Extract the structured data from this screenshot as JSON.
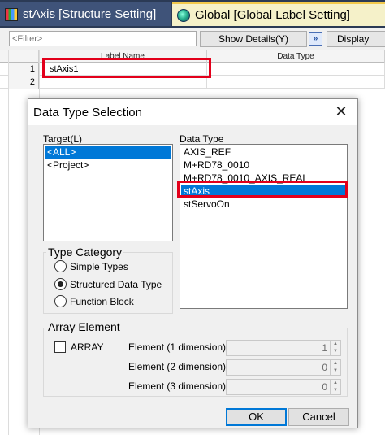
{
  "tabs": [
    {
      "label": "stAxis [Structure Setting]",
      "icon": "structure-icon"
    },
    {
      "label": "Global [Global Label Setting]",
      "icon": "globe-icon"
    }
  ],
  "toolbar": {
    "filter_placeholder": "<Filter>",
    "show_details_label": "Show Details(Y)",
    "expand_icon": "double-chevron-right-icon",
    "display_label": "Display"
  },
  "grid": {
    "columns": [
      "Label Name",
      "Data Type"
    ],
    "rows": [
      {
        "num": "1",
        "label_name": "stAxis1",
        "data_type": ""
      },
      {
        "num": "2",
        "label_name": "",
        "data_type": ""
      }
    ],
    "highlight_color": "#e3001b"
  },
  "dialog": {
    "title": "Data Type Selection",
    "close_icon": "close-icon",
    "target_label": "Target(L)",
    "target_items": [
      "<ALL>",
      "<Project>"
    ],
    "target_selected": "<ALL>",
    "data_type_label": "Data Type",
    "data_type_items": [
      "AXIS_REF",
      "M+RD78_0010",
      "M+RD78_0010_AXIS_REAL",
      "stAxis",
      "stServoOn"
    ],
    "data_type_selected": "stAxis",
    "type_category": {
      "title": "Type Category",
      "options": [
        "Simple Types",
        "Structured Data Type",
        "Function Block"
      ],
      "selected": "Structured Data Type"
    },
    "array_element": {
      "title": "Array Element",
      "checkbox_label": "ARRAY",
      "checked": false,
      "dimensions": [
        {
          "label": "Element (1 dimension)",
          "value": "1"
        },
        {
          "label": "Element (2 dimension)",
          "value": "0"
        },
        {
          "label": "Element (3 dimension)",
          "value": "0"
        }
      ]
    },
    "ok_label": "OK",
    "cancel_label": "Cancel",
    "accent_color": "#0078d7"
  }
}
